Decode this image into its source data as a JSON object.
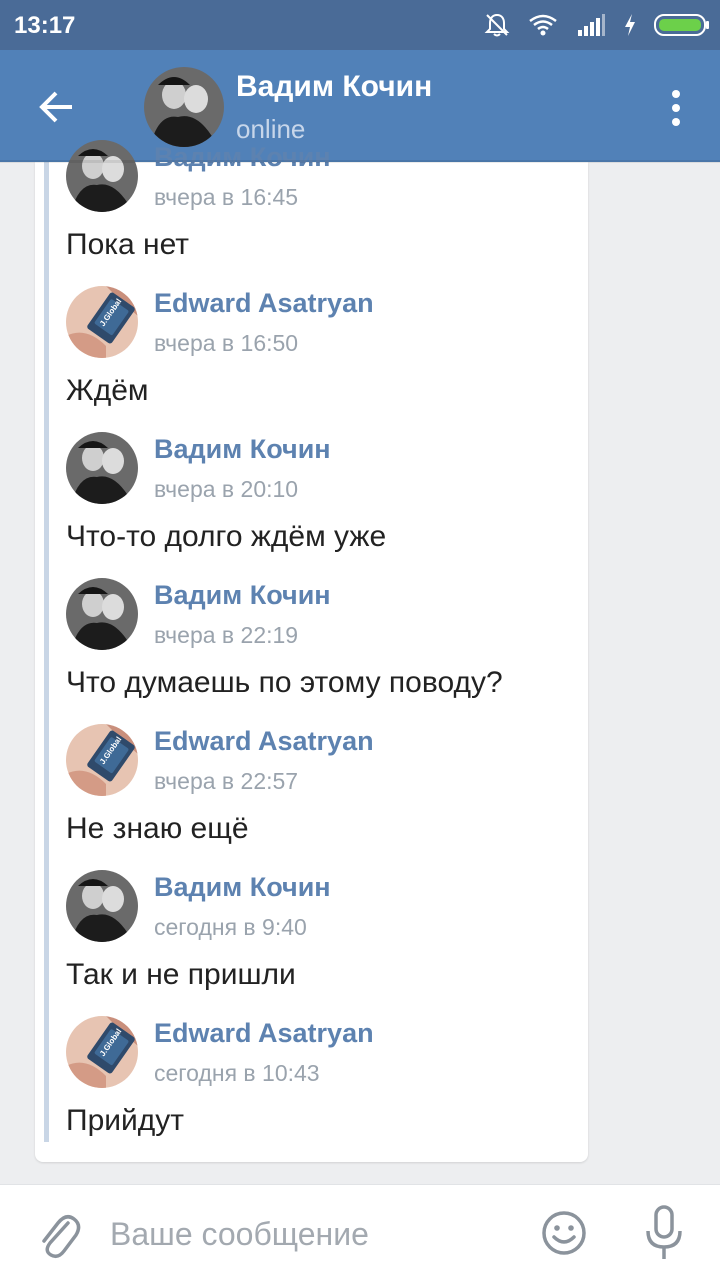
{
  "status_bar": {
    "time": "13:17",
    "icons": [
      "mute-bell-icon",
      "wifi-icon",
      "signal-icon",
      "charging-icon",
      "battery-icon"
    ]
  },
  "header": {
    "title": "Вадим Кочин",
    "subtitle": "online",
    "back_icon": "arrow-left-icon",
    "menu_icon": "more-vertical-icon"
  },
  "messages": [
    {
      "author": "Вадим Кочин",
      "time": "вчера в 16:45",
      "text": "Пока нет",
      "avatar": "vadim"
    },
    {
      "author": "Edward Asatryan",
      "time": "вчера в 16:50",
      "text": "Ждём",
      "avatar": "edward"
    },
    {
      "author": "Вадим Кочин",
      "time": "вчера в 20:10",
      "text": "Что-то долго ждём уже",
      "avatar": "vadim"
    },
    {
      "author": "Вадим Кочин",
      "time": "вчера в 22:19",
      "text": "Что думаешь по этому поводу?",
      "avatar": "vadim"
    },
    {
      "author": "Edward Asatryan",
      "time": "вчера в 22:57",
      "text": "Не знаю ещё",
      "avatar": "edward"
    },
    {
      "author": "Вадим Кочин",
      "time": "сегодня в 9:40",
      "text": "Так и не пришли",
      "avatar": "vadim"
    },
    {
      "author": "Edward Asatryan",
      "time": "сегодня в 10:43",
      "text": "Прийдут",
      "avatar": "edward"
    }
  ],
  "avatar_badge_text": "J.Global",
  "composer": {
    "placeholder": "Ваше сообщение",
    "attach_icon": "paperclip-icon",
    "emoji_icon": "smiley-icon",
    "mic_icon": "microphone-icon"
  },
  "colors": {
    "status_bar": "#4a6b97",
    "header": "#5181b8",
    "author_link": "#5d82b0",
    "background": "#edeef0"
  }
}
